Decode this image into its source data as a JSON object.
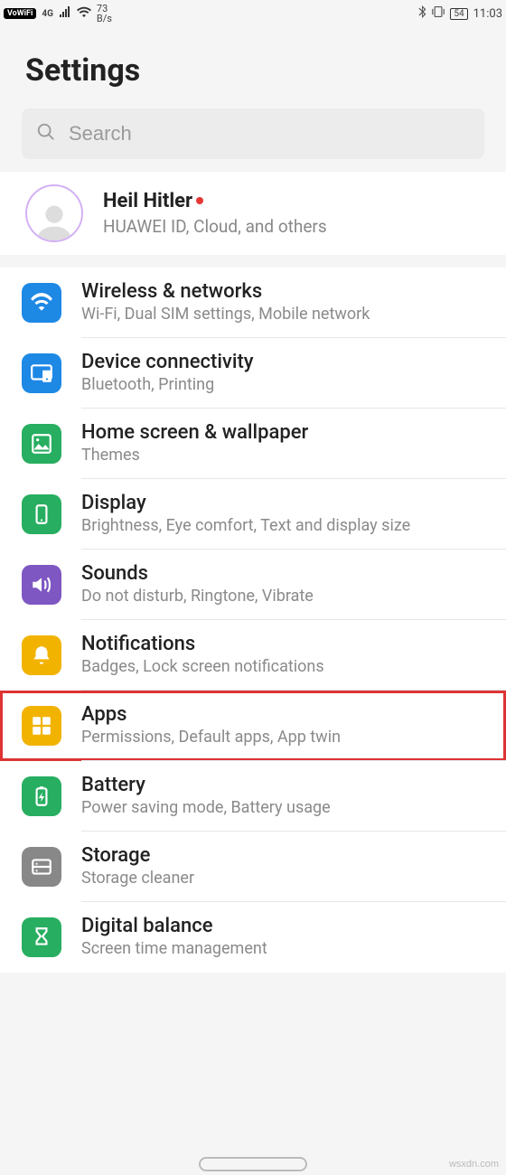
{
  "status": {
    "vowifi": "VoWiFi",
    "net": "4G",
    "speed_value": "73",
    "speed_unit": "B/s",
    "battery": "54",
    "time": "11:03"
  },
  "header": {
    "title": "Settings"
  },
  "search": {
    "placeholder": "Search"
  },
  "account": {
    "name": "Heil Hitler",
    "subtitle": "HUAWEI ID, Cloud, and others"
  },
  "items": [
    {
      "id": "wireless",
      "title": "Wireless & networks",
      "subtitle": "Wi-Fi, Dual SIM settings, Mobile network",
      "icon": "wifi-icon",
      "color": "bg-blue"
    },
    {
      "id": "connectivity",
      "title": "Device connectivity",
      "subtitle": "Bluetooth, Printing",
      "icon": "devices-icon",
      "color": "bg-blue"
    },
    {
      "id": "home",
      "title": "Home screen & wallpaper",
      "subtitle": "Themes",
      "icon": "image-icon",
      "color": "bg-green"
    },
    {
      "id": "display",
      "title": "Display",
      "subtitle": "Brightness, Eye comfort, Text and display size",
      "icon": "phone-icon",
      "color": "bg-green"
    },
    {
      "id": "sounds",
      "title": "Sounds",
      "subtitle": "Do not disturb, Ringtone, Vibrate",
      "icon": "speaker-icon",
      "color": "bg-purple"
    },
    {
      "id": "notifications",
      "title": "Notifications",
      "subtitle": "Badges, Lock screen notifications",
      "icon": "bell-icon",
      "color": "bg-yellow"
    },
    {
      "id": "apps",
      "title": "Apps",
      "subtitle": "Permissions, Default apps, App twin",
      "icon": "apps-icon",
      "color": "bg-yellow",
      "highlighted": true
    },
    {
      "id": "battery",
      "title": "Battery",
      "subtitle": "Power saving mode, Battery usage",
      "icon": "battery-icon",
      "color": "bg-green"
    },
    {
      "id": "storage",
      "title": "Storage",
      "subtitle": "Storage cleaner",
      "icon": "storage-icon",
      "color": "bg-grey"
    },
    {
      "id": "digital",
      "title": "Digital balance",
      "subtitle": "Screen time management",
      "icon": "hourglass-icon",
      "color": "bg-green"
    }
  ],
  "watermark": "wsxdn.com"
}
